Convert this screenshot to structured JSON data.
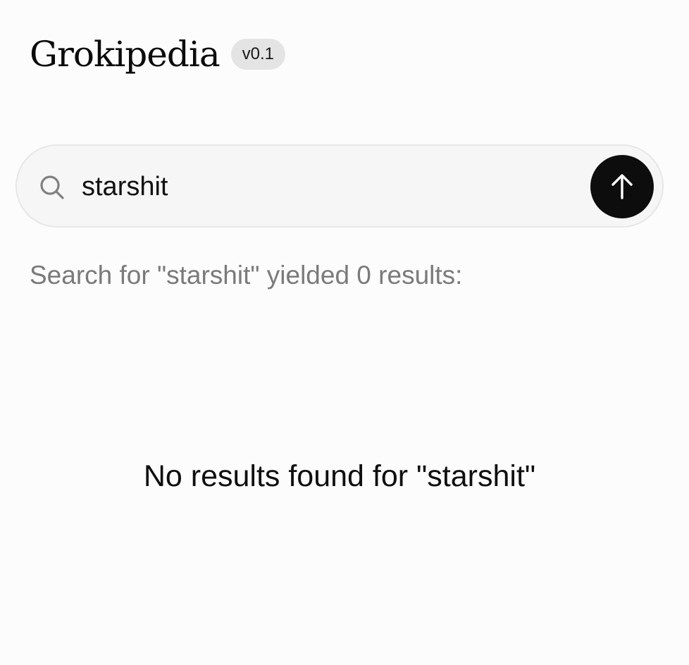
{
  "header": {
    "logo_text": "Grokipedia",
    "version_label": "v0.1"
  },
  "search": {
    "value": "starshit",
    "icon": "search-icon",
    "submit_icon": "arrow-up-icon"
  },
  "results": {
    "summary_text": "Search for \"starshit\" yielded 0 results:",
    "count": 0,
    "empty_message": "No results found for \"starshit\""
  },
  "colors": {
    "background": "#fcfcfc",
    "search_bar_bg": "#f6f6f6",
    "badge_bg": "#e4e4e4",
    "button_bg": "#0d0d0d",
    "muted_text": "#7a7a7a"
  }
}
